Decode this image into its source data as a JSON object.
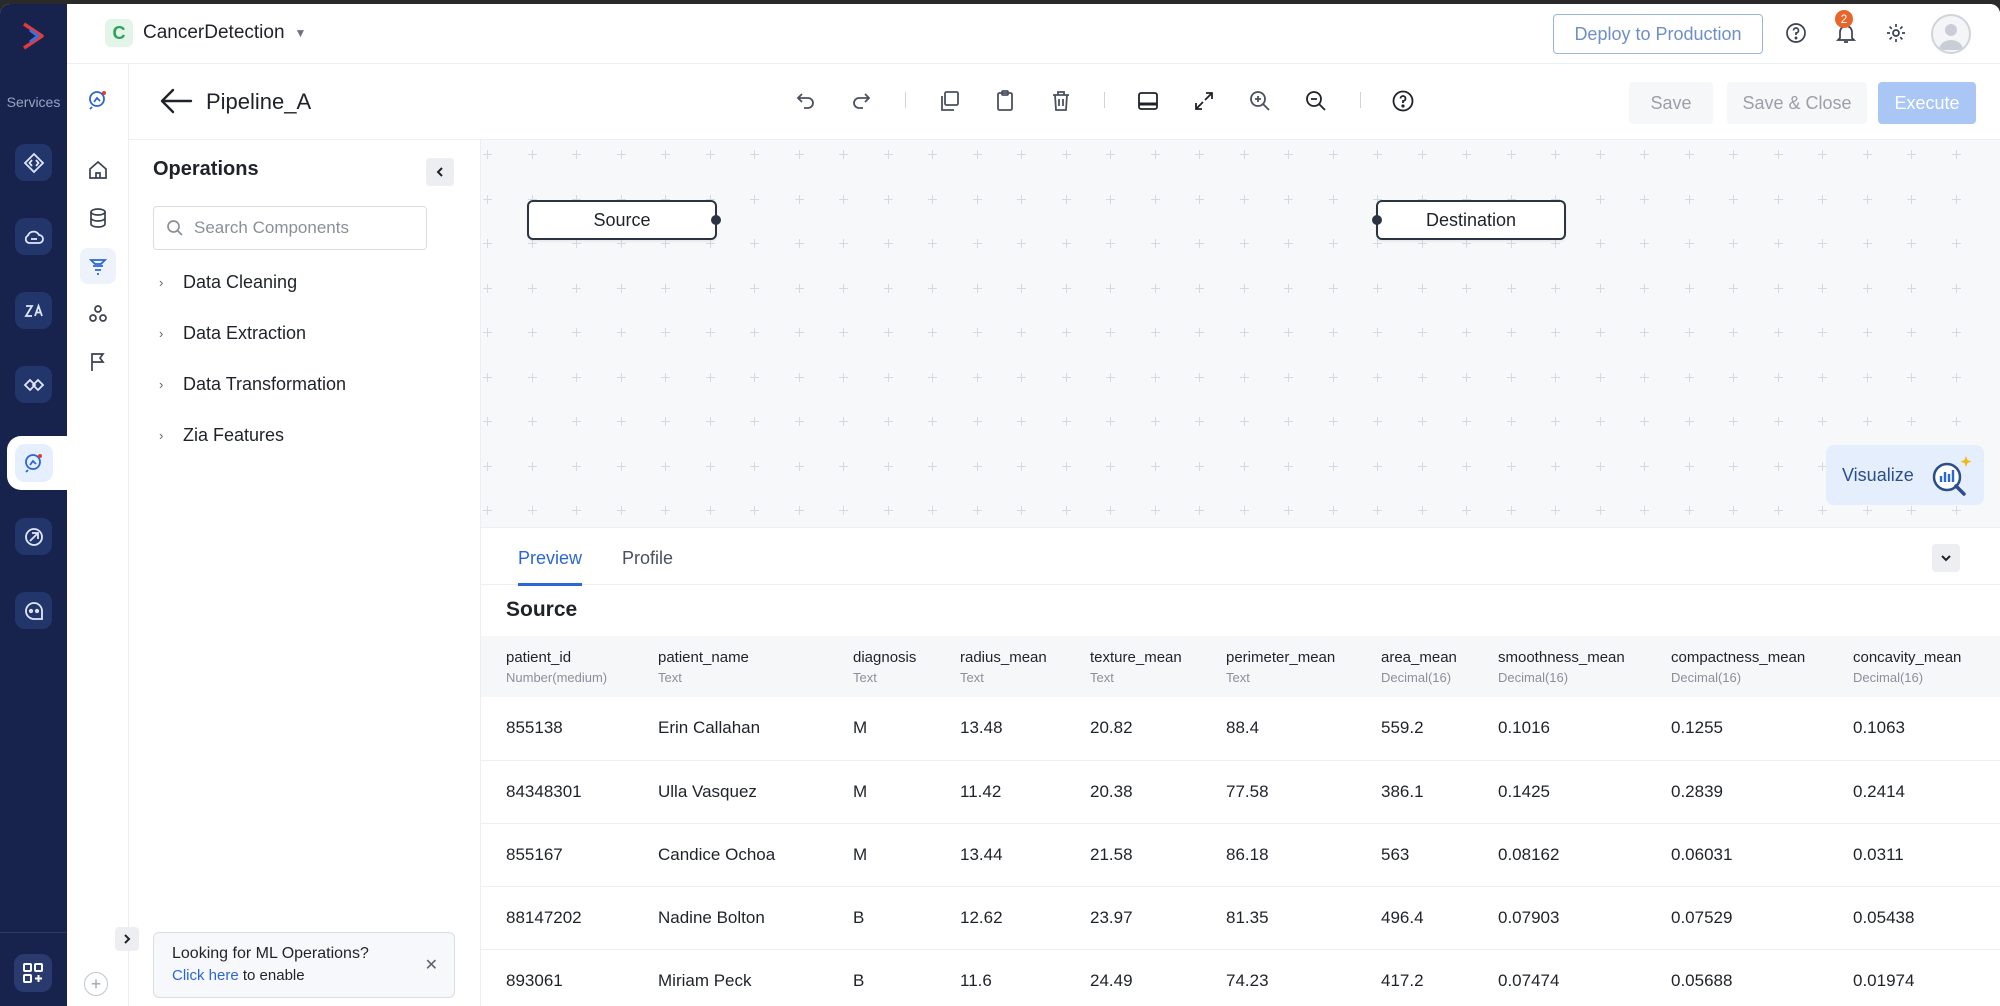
{
  "services": {
    "label": "Services"
  },
  "header": {
    "project_initial": "C",
    "project_name": "CancerDetection",
    "deploy_label": "Deploy to Production",
    "notification_count": "2"
  },
  "toolbar": {
    "pipeline_title": "Pipeline_A",
    "save_label": "Save",
    "save_close_label": "Save & Close",
    "execute_label": "Execute"
  },
  "operations": {
    "title": "Operations",
    "search_placeholder": "Search Components",
    "categories": [
      "Data Cleaning",
      "Data Extraction",
      "Data Transformation",
      "Zia Features"
    ],
    "ml_prompt": "Looking for ML Operations?",
    "ml_link": "Click here",
    "ml_suffix": "to enable"
  },
  "canvas": {
    "source_node": "Source",
    "destination_node": "Destination",
    "visualize_label": "Visualize"
  },
  "panel": {
    "tabs": [
      "Preview",
      "Profile"
    ],
    "active_tab": "Preview",
    "section_title": "Source",
    "columns": [
      {
        "name": "patient_id",
        "type": "Number(medium)"
      },
      {
        "name": "patient_name",
        "type": "Text"
      },
      {
        "name": "diagnosis",
        "type": "Text"
      },
      {
        "name": "radius_mean",
        "type": "Text"
      },
      {
        "name": "texture_mean",
        "type": "Text"
      },
      {
        "name": "perimeter_mean",
        "type": "Text"
      },
      {
        "name": "area_mean",
        "type": "Decimal(16)"
      },
      {
        "name": "smoothness_mean",
        "type": "Decimal(16)"
      },
      {
        "name": "compactness_mean",
        "type": "Decimal(16)"
      },
      {
        "name": "concavity_mean",
        "type": "Decimal(16)"
      }
    ],
    "rows": [
      [
        "855138",
        "Erin Callahan",
        "M",
        "13.48",
        "20.82",
        "88.4",
        "559.2",
        "0.1016",
        "0.1255",
        "0.1063"
      ],
      [
        "84348301",
        "Ulla Vasquez",
        "M",
        "11.42",
        "20.38",
        "77.58",
        "386.1",
        "0.1425",
        "0.2839",
        "0.2414"
      ],
      [
        "855167",
        "Candice Ochoa",
        "M",
        "13.44",
        "21.58",
        "86.18",
        "563",
        "0.08162",
        "0.06031",
        "0.0311"
      ],
      [
        "88147202",
        "Nadine Bolton",
        "B",
        "12.62",
        "23.97",
        "81.35",
        "496.4",
        "0.07903",
        "0.07529",
        "0.05438"
      ],
      [
        "893061",
        "Miriam Peck",
        "B",
        "11.6",
        "24.49",
        "74.23",
        "417.2",
        "0.07474",
        "0.05688",
        "0.01974"
      ]
    ]
  },
  "colors": {
    "rail": "#17234d",
    "accent": "#2b66d6",
    "notification": "#e8652b"
  }
}
